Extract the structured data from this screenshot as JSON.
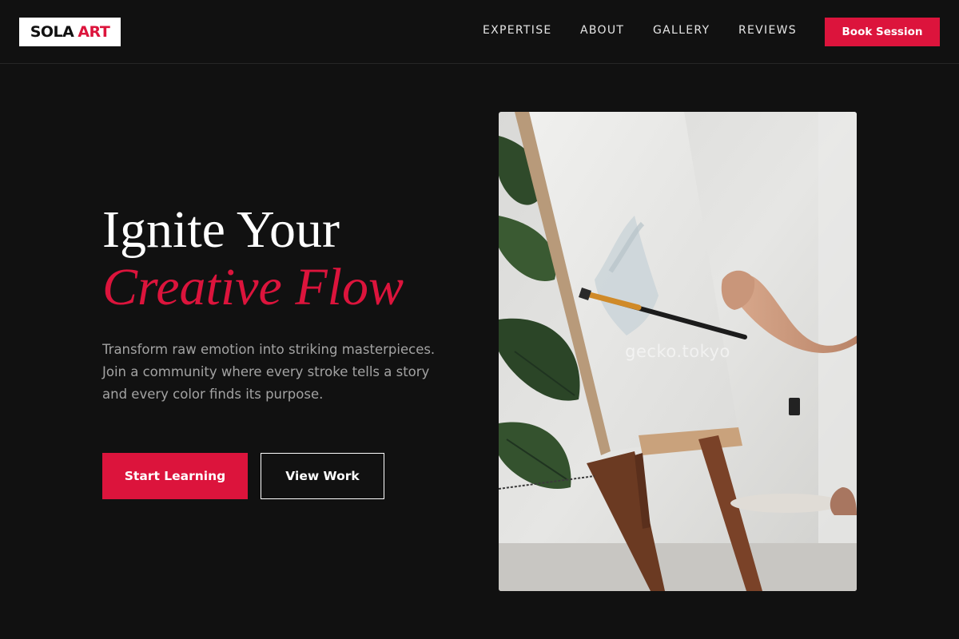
{
  "brand": {
    "name_part1": "SOLA",
    "name_part2": "ART",
    "accent_color": "#dc143c"
  },
  "nav": {
    "items": [
      {
        "label": "EXPERTISE"
      },
      {
        "label": "ABOUT"
      },
      {
        "label": "GALLERY"
      },
      {
        "label": "REVIEWS"
      }
    ],
    "cta_label": "Book Session"
  },
  "hero": {
    "title_line1": "Ignite Your",
    "title_line2": "Creative Flow",
    "description": "Transform raw emotion into striking masterpieces. Join a community where every stroke tells a story and every color finds its purpose.",
    "primary_button": "Start Learning",
    "secondary_button": "View Work",
    "image": {
      "alt": "Person painting on a canvas on a wooden easel next to a plant",
      "watermark": "gecko.tokyo"
    }
  },
  "colors": {
    "background": "#111111",
    "accent": "#dc143c",
    "text_muted": "#a3a3a3"
  }
}
